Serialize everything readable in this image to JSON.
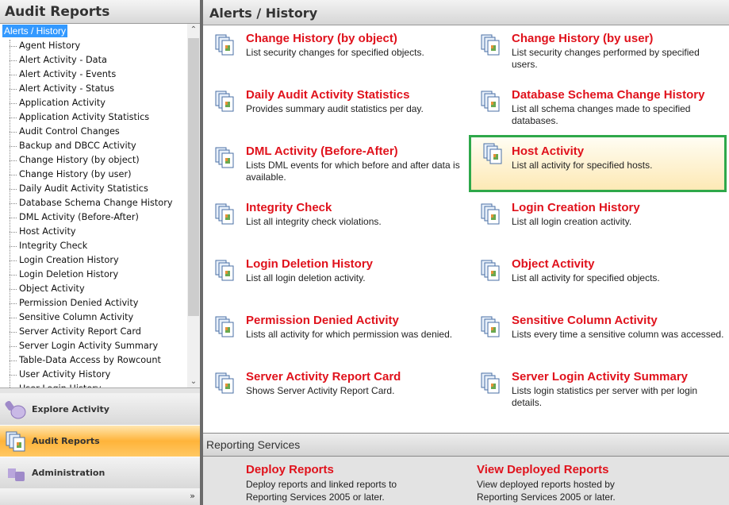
{
  "left": {
    "title": "Audit Reports",
    "tree_root": "Alerts /  History",
    "items": [
      "Agent History",
      "Alert Activity - Data",
      "Alert Activity - Events",
      "Alert Activity - Status",
      "Application Activity",
      "Application Activity Statistics",
      "Audit Control Changes",
      "Backup and DBCC Activity",
      "Change History (by object)",
      "Change History (by user)",
      "Daily Audit Activity Statistics",
      "Database Schema Change History",
      "DML Activity (Before-After)",
      "Host Activity",
      "Integrity Check",
      "Login Creation History",
      "Login Deletion History",
      "Object Activity",
      "Permission Denied Activity",
      "Sensitive Column Activity",
      "Server Activity Report Card",
      "Server Login Activity Summary",
      "Table-Data Access by Rowcount",
      "User Activity History",
      "User Login History"
    ],
    "nav": [
      "Explore Activity",
      "Audit Reports",
      "Administration"
    ],
    "nav_more": "»"
  },
  "main": {
    "title": "Alerts /  History",
    "cards": [
      {
        "title": "Change History (by object)",
        "desc": "List security changes for specified objects."
      },
      {
        "title": "Change History (by user)",
        "desc": "List security changes performed by specified users."
      },
      {
        "title": "Daily Audit Activity Statistics",
        "desc": "Provides summary audit statistics per day."
      },
      {
        "title": "Database Schema Change History",
        "desc": "List all schema changes made to specified databases."
      },
      {
        "title": "DML Activity (Before-After)",
        "desc": "Lists DML events for which before and after data is available."
      },
      {
        "title": "Host Activity",
        "desc": "List all activity for specified hosts."
      },
      {
        "title": "Integrity Check",
        "desc": "List all integrity check violations."
      },
      {
        "title": "Login Creation History",
        "desc": "List all login creation activity."
      },
      {
        "title": "Login Deletion History",
        "desc": "List all login deletion activity."
      },
      {
        "title": "Object Activity",
        "desc": "List all activity for specified objects."
      },
      {
        "title": "Permission Denied Activity",
        "desc": "Lists all activity for which permission was denied."
      },
      {
        "title": "Sensitive Column Activity",
        "desc": "Lists every time a sensitive column was accessed."
      },
      {
        "title": "Server Activity Report Card",
        "desc": "Shows Server Activity Report Card."
      },
      {
        "title": "Server Login Activity Summary",
        "desc": "Lists login statistics per server with per login details."
      }
    ],
    "selected_index": 5,
    "reporting": {
      "title": "Reporting Services",
      "items": [
        {
          "title": "Deploy Reports",
          "desc": "Deploy reports and linked reports to Reporting Services 2005 or later."
        },
        {
          "title": "View Deployed Reports",
          "desc": "View deployed reports hosted by Reporting Services 2005 or later."
        }
      ]
    }
  },
  "colors": {
    "accent": "#e0121c",
    "selection": "#2ea84a",
    "nav_active": "#ffb43a"
  }
}
